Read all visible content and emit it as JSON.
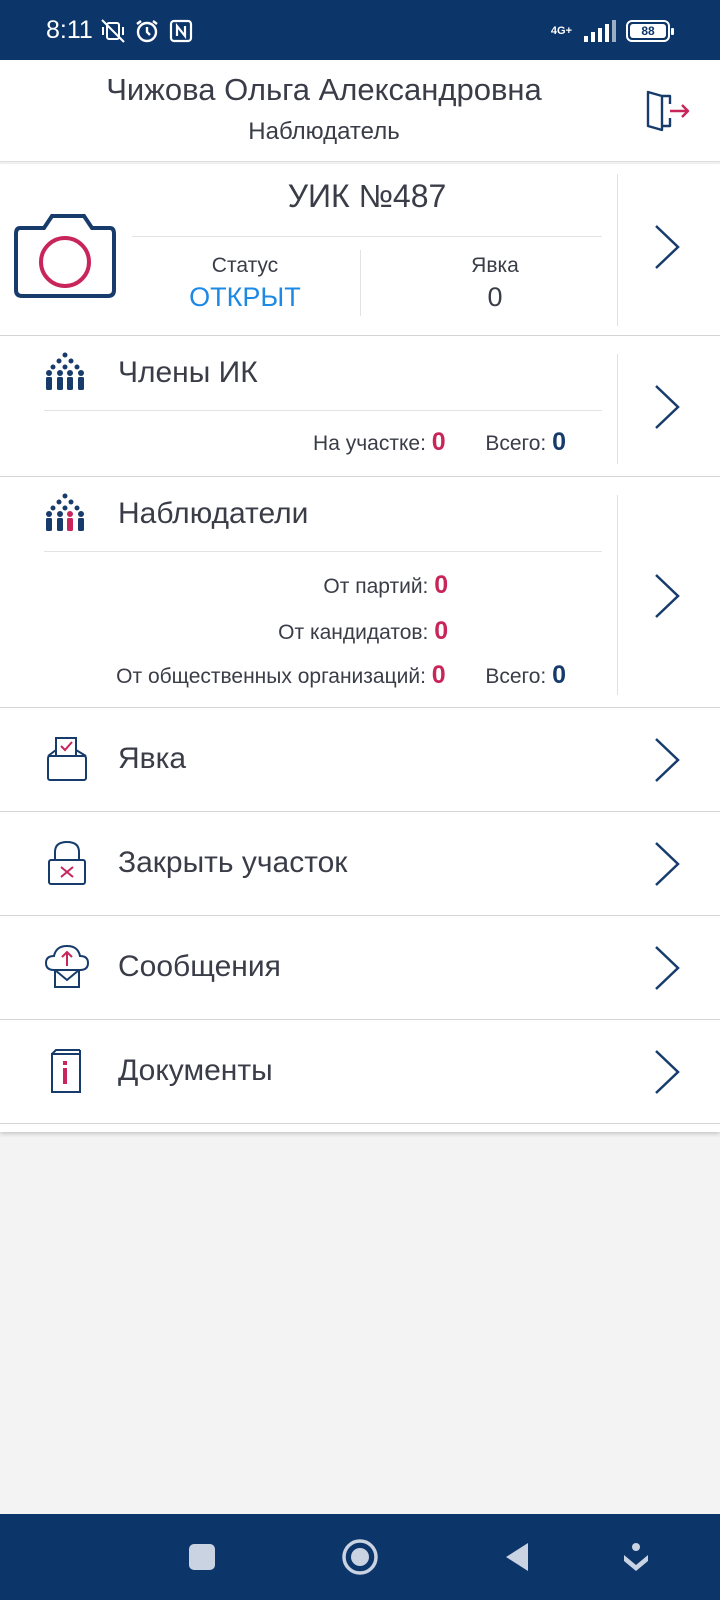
{
  "status_bar": {
    "time": "8:11",
    "network": "4G+",
    "battery": "88"
  },
  "header": {
    "name": "Чижова Ольга Александровна",
    "role": "Наблюдатель"
  },
  "uik": {
    "title": "УИК №487",
    "status_label": "Статус",
    "status_value": "ОТКРЫТ",
    "turnout_label": "Явка",
    "turnout_value": "0"
  },
  "members": {
    "title": "Члены ИК",
    "on_site_label": "На участке:",
    "on_site_value": "0",
    "total_label": "Всего:",
    "total_value": "0"
  },
  "observers": {
    "title": "Наблюдатели",
    "parties_label": "От партий:",
    "parties_value": "0",
    "candidates_label": "От кандидатов:",
    "candidates_value": "0",
    "public_label": "От общественных организаций:",
    "public_value": "0",
    "total_label": "Всего:",
    "total_value": "0"
  },
  "menu": [
    {
      "label": "Явка",
      "icon": "ballot-box-icon"
    },
    {
      "label": "Закрыть участок",
      "icon": "lock-icon"
    },
    {
      "label": "Сообщения",
      "icon": "cloud-mail-icon"
    },
    {
      "label": "Документы",
      "icon": "document-info-icon"
    }
  ],
  "colors": {
    "brand_navy": "#0c3569",
    "accent_red": "#c8255a",
    "status_blue": "#1e88e5"
  }
}
